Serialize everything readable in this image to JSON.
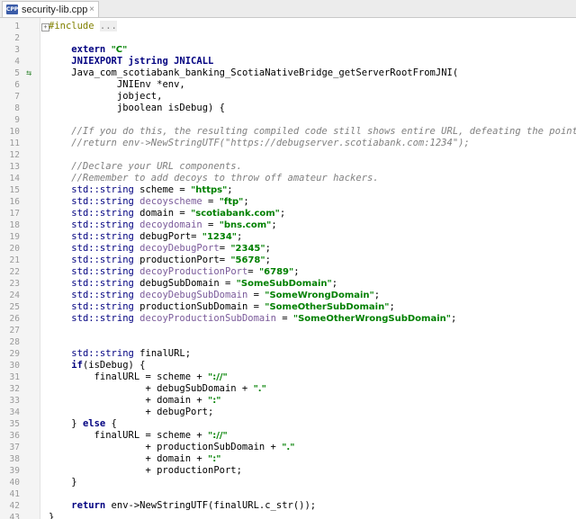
{
  "tab": {
    "title": "security-lib.cpp",
    "icon": "cpp-file-icon",
    "icon_text": "CPP",
    "close": "×"
  },
  "gutter": {
    "line_numbers": [
      "1",
      "2",
      "3",
      "4",
      "5",
      "6",
      "7",
      "8",
      "9",
      "10",
      "11",
      "12",
      "13",
      "14",
      "15",
      "16",
      "17",
      "18",
      "19",
      "20",
      "21",
      "22",
      "23",
      "24",
      "25",
      "26",
      "27",
      "28",
      "29",
      "30",
      "31",
      "32",
      "33",
      "34",
      "35",
      "36",
      "37",
      "38",
      "39",
      "40",
      "41",
      "42",
      "43"
    ],
    "marker_line": 5,
    "marker_icon": "implementation-gutter-icon"
  },
  "code": {
    "l1_prefix": "#include",
    "l1_fold": "...",
    "l3_kw": "extern",
    "l3_str": "\"C\"",
    "l4": "JNIEXPORT jstring JNICALL",
    "l5": "Java_com_scotiabank_banking_ScotiaNativeBridge_getServerRootFromJNI(",
    "l6": "        JNIEnv *env,",
    "l7": "        jobject,",
    "l8": "        jboolean isDebug) {",
    "l10": "    //If you do this, the resulting compiled code still shows entire URL, defeating the point.",
    "l11": "    //return env->NewStringUTF(\"https://debugserver.scotiabank.com:1234\");",
    "l13": "    //Declare your URL components.",
    "l14": "    //Remember to add decoys to throw off amateur hackers.",
    "decls": [
      {
        "name": "scheme",
        "val": "\"https\"",
        "dim": false
      },
      {
        "name": "decoyscheme",
        "val": "\"ftp\"",
        "dim": true
      },
      {
        "name": "domain",
        "val": "\"scotiabank.com\"",
        "dim": false
      },
      {
        "name": "decoydomain",
        "val": "\"bns.com\"",
        "dim": true
      },
      {
        "name": "debugPort",
        "val": "\"1234\"",
        "dim": false,
        "tight": true
      },
      {
        "name": "decoyDebugPort",
        "val": "\"2345\"",
        "dim": true,
        "tight": true
      },
      {
        "name": "productionPort",
        "val": "\"5678\"",
        "dim": false,
        "tight": true
      },
      {
        "name": "decoyProductionPort",
        "val": "\"6789\"",
        "dim": true,
        "tight": true
      },
      {
        "name": "debugSubDomain",
        "val": "\"SomeSubDomain\"",
        "dim": false
      },
      {
        "name": "decoyDebugSubDomain",
        "val": "\"SomeWrongDomain\"",
        "dim": true
      },
      {
        "name": "productionSubDomain",
        "val": "\"SomeOtherSubDomain\"",
        "dim": false
      },
      {
        "name": "decoyProductionSubDomain",
        "val": "\"SomeOtherWrongSubDomain\"",
        "dim": true
      }
    ],
    "std_prefix": "std::",
    "string_type": "string",
    "l29": "finalURL;",
    "l30_kw": "if",
    "l30_rest": "(isDebug) {",
    "l31_a": "        finalURL = scheme + ",
    "l31_s": "\"://\"",
    "l32_a": "                 + debugSubDomain + ",
    "l32_s": "\".\"",
    "l33_a": "                 + domain + ",
    "l33_s": "\":\"",
    "l34": "                 + debugPort;",
    "l35_a": "    } ",
    "l35_kw": "else",
    "l35_b": " {",
    "l36_a": "        finalURL = scheme + ",
    "l36_s": "\"://\"",
    "l37_a": "                 + productionSubDomain + ",
    "l37_s": "\".\"",
    "l38_a": "                 + domain + ",
    "l38_s": "\":\"",
    "l39": "                 + productionPort;",
    "l40": "    }",
    "l42_kw": "return",
    "l42_rest": " env->NewStringUTF(finalURL.c_str());",
    "l43": "}"
  }
}
